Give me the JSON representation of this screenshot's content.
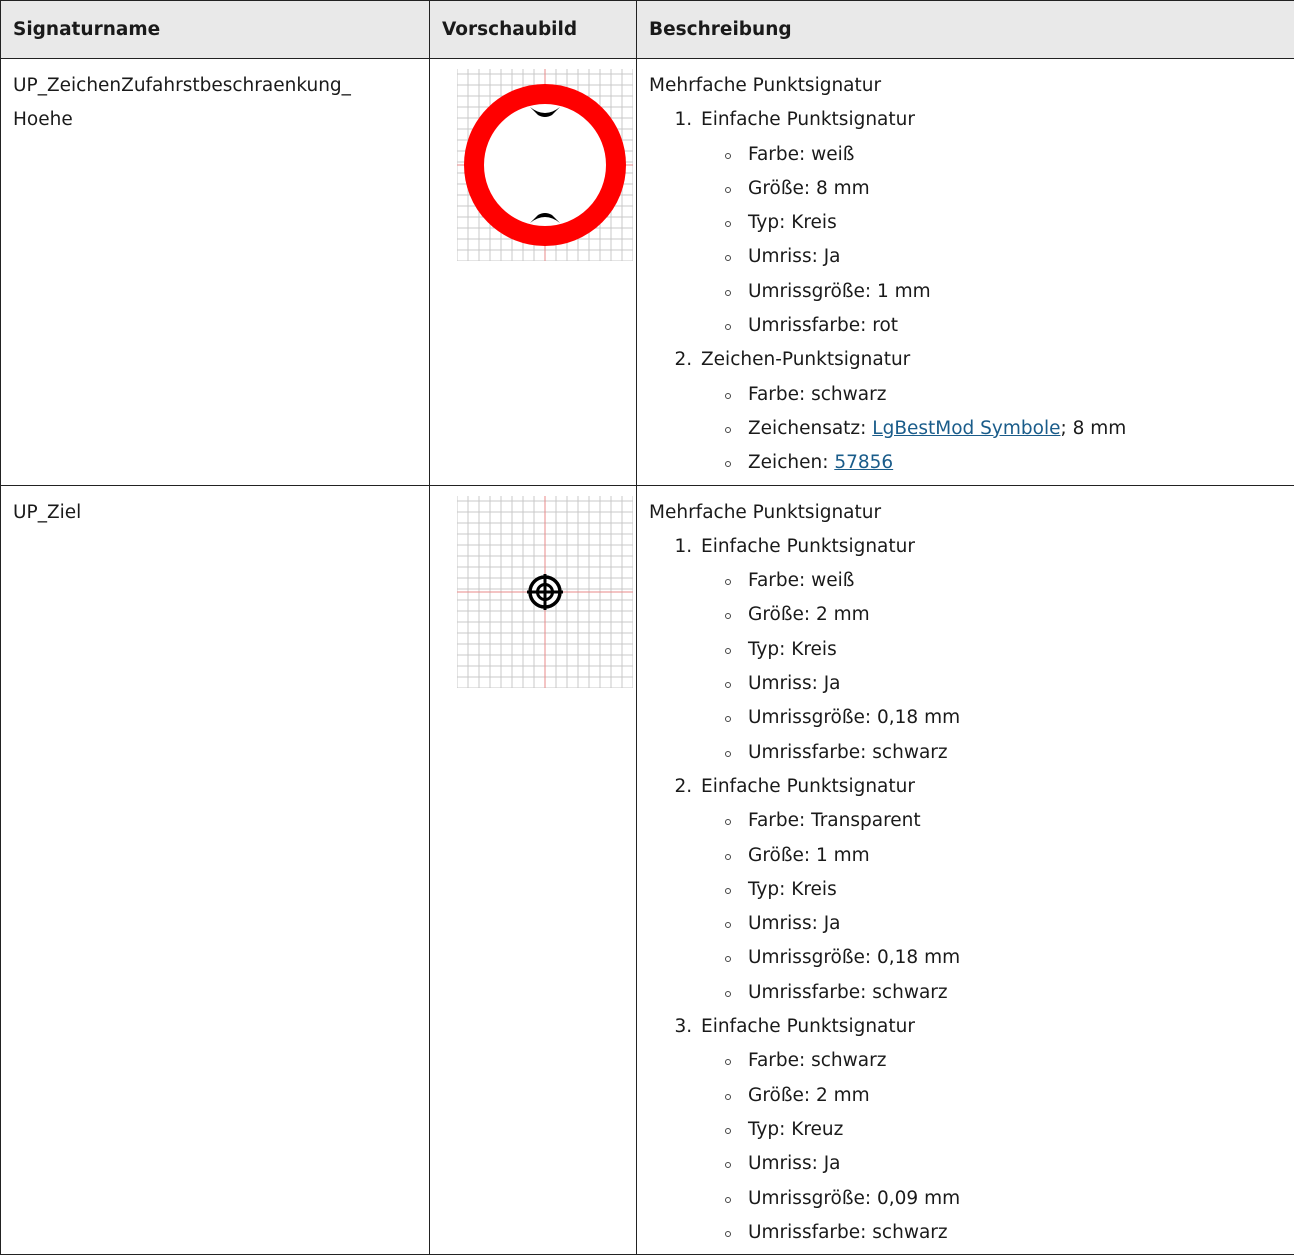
{
  "headers": {
    "name": "Signaturname",
    "preview": "Vorschaubild",
    "description": "Beschreibung"
  },
  "rows": [
    {
      "name_line1": "UP_ZeichenZufahrstbeschraenkung_",
      "name_line2": "Hoehe",
      "preview_icon": "height-restriction-sign-icon",
      "title": "Mehrfache Punktsignatur",
      "parts": [
        {
          "label": "Einfache Punktsignatur",
          "props": [
            "Farbe: weiß",
            "Größe: 8 mm",
            "Typ: Kreis",
            "Umriss: Ja",
            "Umrissgröße: 1 mm",
            "Umrissfarbe: rot"
          ]
        },
        {
          "label": "Zeichen-Punktsignatur",
          "props": [
            "Farbe: schwarz"
          ],
          "font_prefix": "Zeichensatz: ",
          "font_link": "LgBestMod Symbole",
          "font_suffix": "; 8 mm",
          "char_prefix": "Zeichen: ",
          "char_link": "57856"
        }
      ]
    },
    {
      "name_line1": "UP_Ziel",
      "preview_icon": "crosshair-target-icon",
      "title": "Mehrfache Punktsignatur",
      "parts": [
        {
          "label": "Einfache Punktsignatur",
          "props": [
            "Farbe: weiß",
            "Größe: 2 mm",
            "Typ: Kreis",
            "Umriss: Ja",
            "Umrissgröße: 0,18 mm",
            "Umrissfarbe: schwarz"
          ]
        },
        {
          "label": "Einfache Punktsignatur",
          "props": [
            "Farbe: Transparent",
            "Größe: 1 mm",
            "Typ: Kreis",
            "Umriss: Ja",
            "Umrissgröße: 0,18 mm",
            "Umrissfarbe: schwarz"
          ]
        },
        {
          "label": "Einfache Punktsignatur",
          "props": [
            "Farbe: schwarz",
            "Größe: 2 mm",
            "Typ: Kreuz",
            "Umriss: Ja",
            "Umrissgröße: 0,09 mm",
            "Umrissfarbe: schwarz"
          ]
        }
      ]
    }
  ],
  "colors": {
    "grid_line": "#c8c8c8",
    "axis_line": "#e88a8a",
    "sign_red": "#ff0000",
    "link": "#1a5c8a"
  }
}
